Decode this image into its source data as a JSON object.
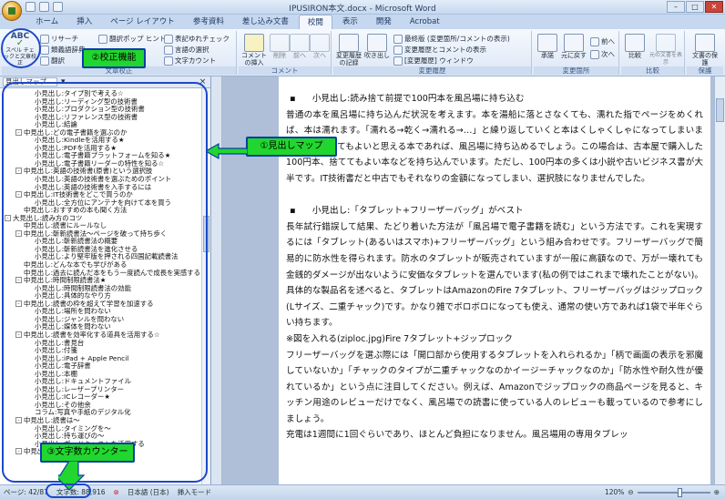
{
  "window": {
    "title": "IPUSIRON本文.docx - Microsoft Word"
  },
  "tabs": [
    "ホーム",
    "挿入",
    "ページ レイアウト",
    "参考資料",
    "差し込み文書",
    "校閲",
    "表示",
    "開発",
    "Acrobat"
  ],
  "ribbon": {
    "proofing": {
      "spelling": "スペル チェックと文章校正",
      "research": "リサーチ",
      "thesaurus": "類義語辞典",
      "translate": "翻訳",
      "translate_tip": "翻訳ポップ ヒント",
      "ime": "表記ゆれチェック",
      "language": "言語の選択",
      "wordcount": "文字カウント",
      "label": "文章校正"
    },
    "comments": {
      "new": "コメントの挿入",
      "delete": "削除",
      "prev": "前へ",
      "next": "次へ",
      "label": "コメント"
    },
    "tracking": {
      "track": "変更履歴の記録",
      "balloons": "吹き出し",
      "display": "最終版 (変更箇所/コメントの表示)",
      "markup": "変更履歴とコメントの表示",
      "pane": "[変更履歴] ウィンドウ",
      "label": "変更履歴"
    },
    "changes": {
      "accept": "承諾",
      "reject": "元に戻す",
      "prev": "前へ",
      "next": "次へ",
      "label": "変更箇所"
    },
    "compare": {
      "compare": "比較",
      "show_source": "元の文書を表示",
      "label": "比較"
    },
    "protect": {
      "protect": "文書の保護",
      "label": "保護"
    }
  },
  "nav": {
    "dropdown": "見出しマップ",
    "items": [
      {
        "t": "小見出し:タイプ別で考える☆",
        "lv": 2
      },
      {
        "t": "小見出し:リーディング型の技術書",
        "lv": 2
      },
      {
        "t": "小見出し:プロダクション型の技術書",
        "lv": 2
      },
      {
        "t": "小見出し:リファレンス型の技術書",
        "lv": 2
      },
      {
        "t": "小見出し:結論",
        "lv": 2
      },
      {
        "t": "中見出し:どの電子書籍を選ぶのか",
        "lv": 1,
        "tg": "⊟"
      },
      {
        "t": "小見出し:Kindleを活用する★",
        "lv": 2
      },
      {
        "t": "小見出し:PDFを活用する★",
        "lv": 2
      },
      {
        "t": "小見出し:電子書籍プラットフォームを知る★",
        "lv": 2
      },
      {
        "t": "小見出し:電子書籍リーダーの特性を知る☆",
        "lv": 2
      },
      {
        "t": "中見出し:英語の技術書(原書)という選択肢",
        "lv": 1,
        "tg": "⊟"
      },
      {
        "t": "小見出し:英語の技術書を選ぶためのポイント",
        "lv": 2
      },
      {
        "t": "小見出し:英語の技術書を入手するには",
        "lv": 2
      },
      {
        "t": "中見出し:IT技術書をどこで買うのか",
        "lv": 1,
        "tg": "⊟"
      },
      {
        "t": "小見出し:全方位にアンテナを向けて本を買う",
        "lv": 2
      },
      {
        "t": "中見出し:おすすめの本も聞く方法",
        "lv": 1
      },
      {
        "t": "大見出し:読み方のコツ",
        "lv": 0,
        "tg": "⊟"
      },
      {
        "t": "中見出し:読書にルールなし",
        "lv": 1
      },
      {
        "t": "中見出し:斬新読書法〜ページを破って持ち歩く",
        "lv": 1,
        "tg": "⊟"
      },
      {
        "t": "小見出し:斬新読書法の概要",
        "lv": 2
      },
      {
        "t": "小見出し:斬新読書法を進化させる",
        "lv": 2
      },
      {
        "t": "小見出し:より堅牢版を押される四国記載読書法",
        "lv": 2
      },
      {
        "t": "中見出し:どんな本でも学びがある",
        "lv": 1
      },
      {
        "t": "中見出し:過去に読んだ本をもう一度読んで成長を実感する",
        "lv": 1
      },
      {
        "t": "中見出し:時間制限読書法★",
        "lv": 1,
        "tg": "⊟"
      },
      {
        "t": "小見出し:時間制限読書法の効能",
        "lv": 2
      },
      {
        "t": "小見出し:具体的なやり方",
        "lv": 2
      },
      {
        "t": "中見出し:読書の枠を超えて学習を加速する",
        "lv": 1,
        "tg": "⊟"
      },
      {
        "t": "小見出し:場所を問わない",
        "lv": 2
      },
      {
        "t": "小見出し:ジャンルを問わない",
        "lv": 2
      },
      {
        "t": "小見出し:媒体を問わない",
        "lv": 2
      },
      {
        "t": "中見出し:読書を効率化する道具を活用する☆",
        "lv": 1,
        "tg": "⊟"
      },
      {
        "t": "小見出し:書見台",
        "lv": 2
      },
      {
        "t": "小見出し:付箋",
        "lv": 2
      },
      {
        "t": "小見出し:iPad + Apple Pencil",
        "lv": 2
      },
      {
        "t": "小見出し:電子辞書",
        "lv": 2
      },
      {
        "t": "小見出し:本棚",
        "lv": 2
      },
      {
        "t": "小見出し:ドキュメントファイル",
        "lv": 2
      },
      {
        "t": "小見出し:レーザープリンター",
        "lv": 2
      },
      {
        "t": "小見出し:ICレコーダー★",
        "lv": 2
      },
      {
        "t": "小見出し:その他余",
        "lv": 2
      },
      {
        "t": "コラム:写真や手紙のデジタル化",
        "lv": 2
      },
      {
        "t": "中見出し:読書は〜",
        "lv": 1,
        "tg": "⊟"
      },
      {
        "t": "小見出し:タイミングを〜",
        "lv": 2
      },
      {
        "t": "小見出し:持ち運びの〜",
        "lv": 2
      },
      {
        "t": "小見出し:ポッドキャストを活用する",
        "lv": 2
      },
      {
        "t": "中見出し:風呂場で読むコツ",
        "lv": 1,
        "tg": "⊟"
      }
    ]
  },
  "document": {
    "heading1": "小見出し:読み捨て前提で100円本を風呂場に持ち込む",
    "p1": "普通の本を風呂場に持ち込んだ状況を考えます。本を湯船に落とさなくても、濡れた指でページをめくれば、本は濡れます。「濡れる→乾く→濡れる→…」と繰り返していくと本はくしゃくしゃになってしまいます。こうなってもよいと思える本であれば、風呂場に持ち込めるでしょう。この場合は、古本屋で購入した100円本、捨ててもよい本などを持ち込んでいます。ただし、100円本の多くは小説や古いビジネス書が大半です。IT技術書だと中古でもそれなりの金額になってしまい、選択肢になりませんでした。",
    "heading2": "小見出し:「タブレット+フリーザーバッグ」がベスト",
    "p2": "長年試行錯誤して結果、たどり着いた方法が「風呂場で電子書籍を読む」という方法です。これを実現するには「タブレット(あるいはスマホ)+フリーザーバッグ」という組み合わせです。フリーザーバッグで簡易的に防水性を得られます。防水のタブレットが販売されていますが一般に高額なので、万が一壊れても金銭的ダメージが出ないように安価なタブレットを選んでいます(私の例ではこれまで壊れたことがない)。具体的な製品名を述べると、タブレットはAmazonのFire 7タブレット、フリーザーバッグはジップロック(Lサイズ、二重チャック)です。かなり雑でボロボロになっても使え、通常の使い方であれば1袋で半年ぐらい持ちます。",
    "p3": "※図を入れる(ziploc.jpg)Fire 7タブレット+ジップロック",
    "p4": "フリーザーバッグを選ぶ際には「開口部から使用するタブレットを入れられるか」「柄で画面の表示を邪魔していないか」「チャックのタイプが二重チャックなのかイージーチャックなのか」「防水性や耐久性が優れているか」という点に注目してください。例えば、Amazonでジップロックの商品ページを見ると、キッチン用途のレビューだけでなく、風呂場での読書に使っている人のレビューも載っているので参考にしましょう。",
    "p5": "充電は1週間に1回ぐらいであり、ほとんど負担になりません。風呂場用の専用タブレッ"
  },
  "status": {
    "page": "ページ: 42/87",
    "words": "文字数: 88,916",
    "lang": "日本語 (日本)",
    "mode": "挿入モード",
    "zoom": "120%"
  },
  "callouts": {
    "proofing": "②校正機能",
    "navmap": "①見出しマップ",
    "wordcount": "③文字数カウンター"
  }
}
